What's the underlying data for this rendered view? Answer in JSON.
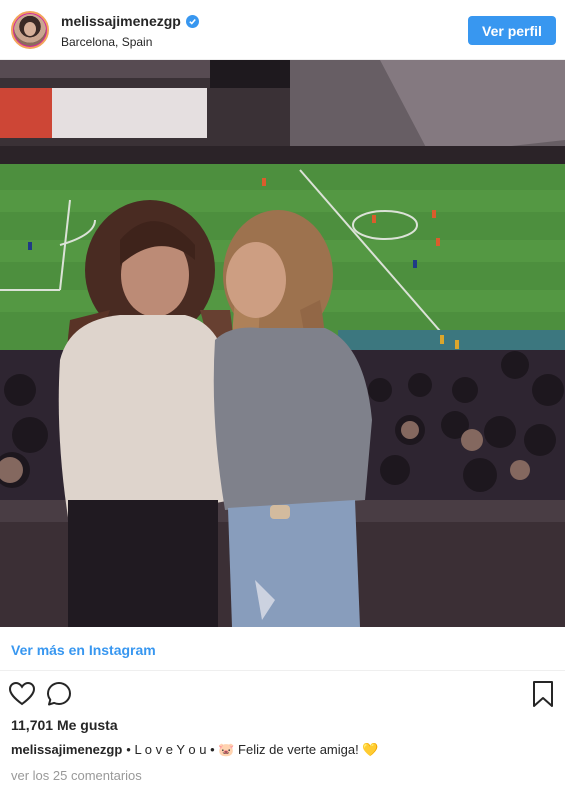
{
  "header": {
    "username": "melissajimenezgp",
    "location": "Barcelona, Spain",
    "profile_button": "Ver perfil"
  },
  "post": {
    "ver_mas_link": "Ver más en Instagram",
    "likes": "11,701 Me gusta",
    "caption_user": "melissajimenezgp",
    "caption_text": "• L o v e Y o u • 🐷 Feliz de verte amiga! 💛",
    "comments_link": "ver los 25 comentarios"
  },
  "colors": {
    "accent": "#3897f0",
    "text": "#262626",
    "muted": "#999999"
  },
  "icons": [
    "verified-icon",
    "heart-icon",
    "comment-icon",
    "bookmark-icon"
  ]
}
